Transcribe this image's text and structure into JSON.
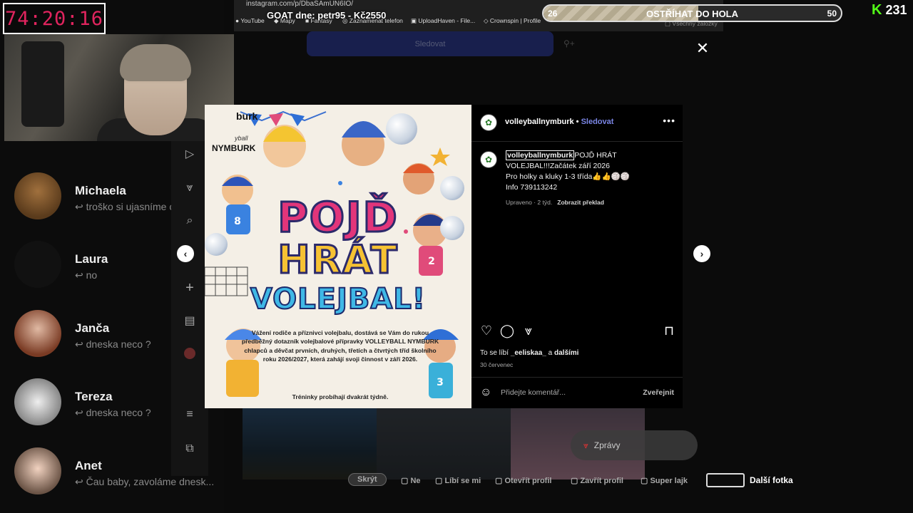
{
  "overlay": {
    "timer": "74:20:16",
    "goat_text": "GOAT dne: petr95 - Kč2550",
    "goal": {
      "current": "26",
      "label": "OSTŘÍHAT DO HOLA",
      "target": "50",
      "fraction": 0.52
    },
    "viewer_count": "231",
    "kick_logo": "K"
  },
  "browser": {
    "url": "instagram.com/p/DbaSAmUN6IO/",
    "bookmarks": [
      "YouTube",
      "Mapy",
      "Fantasy",
      "Zaznamenat telefon",
      "UploadHaven - File...",
      "Crownspin | Profile",
      "Všechny záložky"
    ]
  },
  "contacts": [
    {
      "name": "Michaela",
      "message": "troško si ujasníme c"
    },
    {
      "name": "Laura",
      "message": "no"
    },
    {
      "name": "Janča",
      "message": "dneska neco ?"
    },
    {
      "name": "Tereza",
      "message": "dneska neco ?"
    },
    {
      "name": "Anet",
      "message": "Čau baby, zavoláme dnesk..."
    }
  ],
  "page": {
    "follow_button": "Sledovat",
    "messages_label": "Zprávy"
  },
  "post": {
    "username": "volleyballnymburk",
    "follow": "Sledovat",
    "caption_user": "volleyballnymburk",
    "caption_lines": [
      "POJĎ HRÁT",
      "VOLEJBAL!!!Začátek září 2026",
      "Pro holky a kluky 1-3 třída👍👍🏐🏐",
      "Info 739113242"
    ],
    "edited": "Upraveno · 2 týd.",
    "translate": "Zobrazit překlad",
    "likes_prefix": "To se líbí",
    "likes_user": "_eeliskaa_",
    "likes_and": "a",
    "likes_others": "dalšími",
    "date": "30 červenec",
    "comment_placeholder": "Přidejte komentář...",
    "publish": "Zveřejnit"
  },
  "poster": {
    "brand_top": "burk",
    "brand_small": "yball",
    "brand": "NYMBURK",
    "line1": "POJĎ",
    "line2": "HRÁT",
    "line3": "VOLEJBAL!",
    "body": "Vážení rodiče a příznivci volejbalu, dostává se Vám do rukou předběžný dotazník volejbalové přípravky VOLLEYBALL NYMBURK chlapců a děvčat prvních, druhých, třetích a čtvrtých tříd školního roku 2026/2027, která zahájí svoji činnost v září 2026.",
    "trainings": "Tréninky probíhají dvakrát týdně."
  },
  "bottom_bar": {
    "items": [
      "Skrýt",
      "Ne",
      "Líbí se mi",
      "Otevřít profil",
      "Zavřít profil",
      "Super lajk"
    ],
    "next_photo": "Další fotka"
  },
  "colors": {
    "accent_timer": "#e0245e",
    "kick_green": "#53fc18",
    "ig_blue": "#7b86e6"
  }
}
